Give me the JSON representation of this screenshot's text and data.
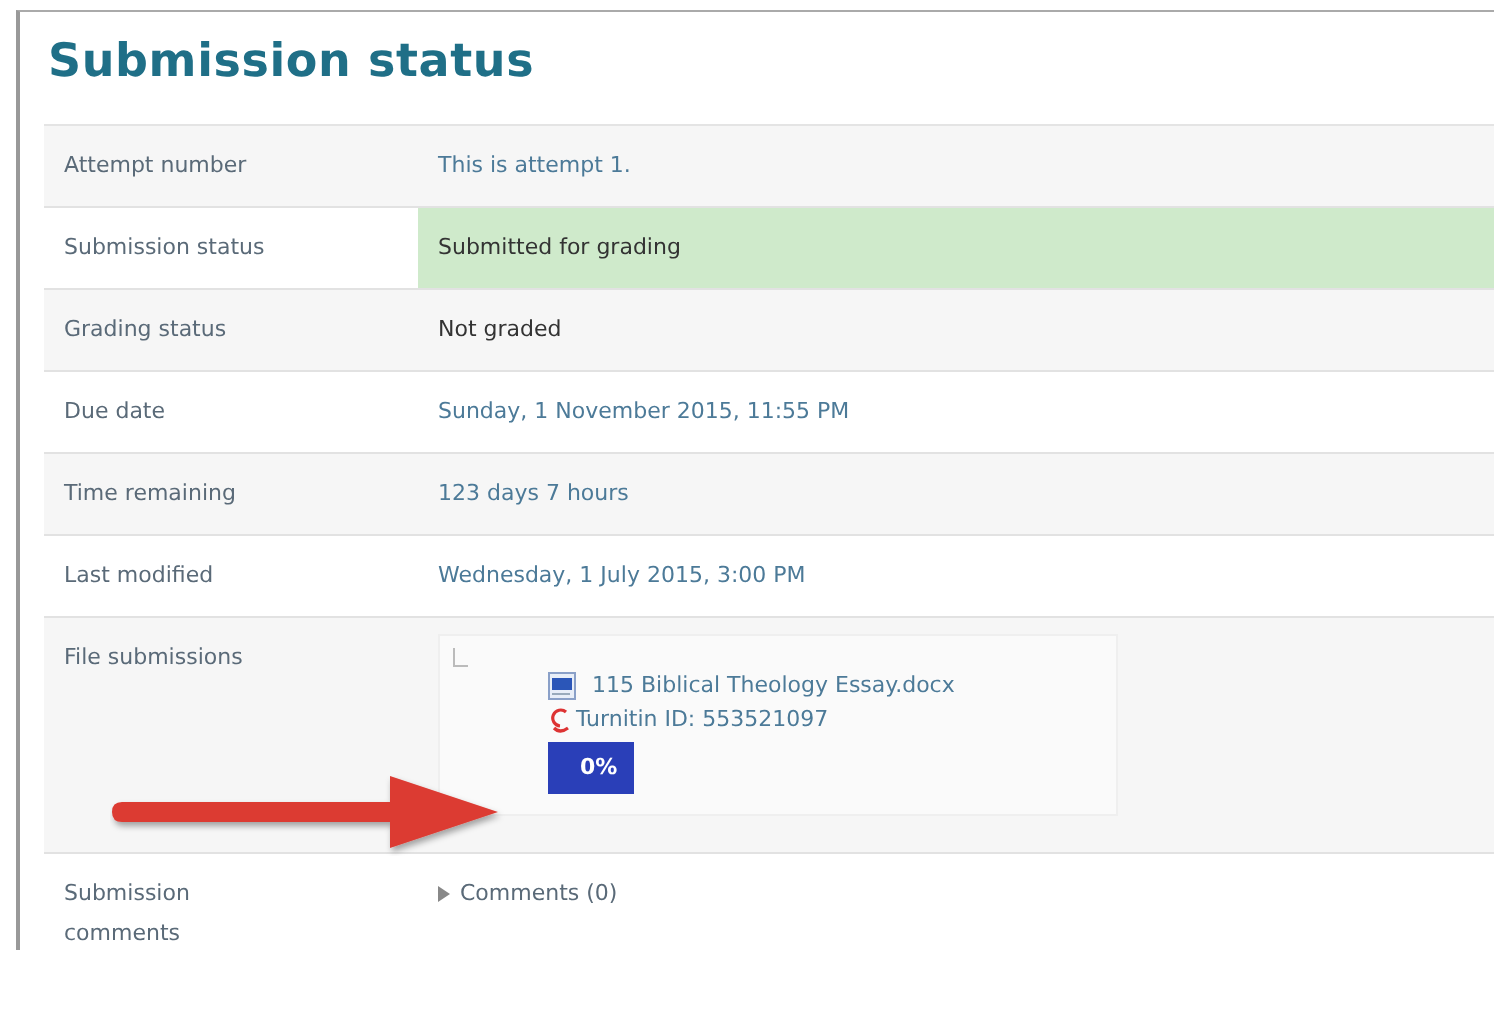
{
  "title": "Submission status",
  "rows": [
    {
      "label": "Attempt number",
      "kind": "text",
      "value": "This is attempt 1."
    },
    {
      "label": "Submission status",
      "kind": "status",
      "value": "Submitted for grading",
      "highlight": true
    },
    {
      "label": "Grading status",
      "kind": "status",
      "value": "Not graded",
      "highlight": false
    },
    {
      "label": "Due date",
      "kind": "text",
      "value": "Sunday, 1 November 2015, 11:55 PM"
    },
    {
      "label": "Time remaining",
      "kind": "text",
      "value": "123 days 7 hours"
    },
    {
      "label": "Last modified",
      "kind": "text",
      "value": "Wednesday, 1 July 2015, 3:00 PM"
    },
    {
      "label": "File submissions",
      "kind": "files",
      "file": {
        "name": "115 Biblical Theology Essay.docx",
        "turnitin": "Turnitin ID: 553521097",
        "score": "0%"
      }
    },
    {
      "label": "Submission comments",
      "kind": "comments",
      "comments": {
        "label": "Comments (0)",
        "expanded": false
      }
    }
  ]
}
